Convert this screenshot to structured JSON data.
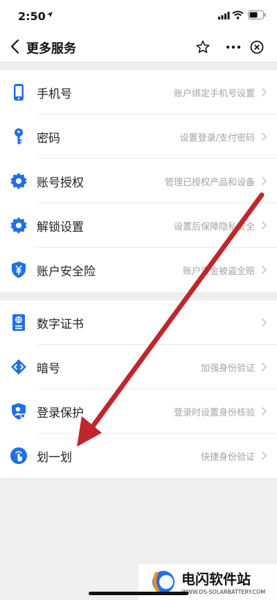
{
  "status_bar": {
    "time": "2:50",
    "icons": [
      "location-arrow-icon",
      "signal-icon",
      "wifi-icon",
      "battery-icon"
    ]
  },
  "nav": {
    "title": "更多服务",
    "icons": [
      "back-icon",
      "star-icon",
      "more-icon",
      "close-icon"
    ]
  },
  "group1": [
    {
      "label": "手机号",
      "desc": "账户绑定手机号设置",
      "icon": "phone-icon"
    },
    {
      "label": "密码",
      "desc": "设置登录/支付密码",
      "icon": "key-icon"
    },
    {
      "label": "账号授权",
      "desc": "管理已授权产品和设备",
      "icon": "gear-icon"
    },
    {
      "label": "解锁设置",
      "desc": "设置后保障隐私安全",
      "icon": "gear-icon"
    },
    {
      "label": "账户安全险",
      "desc": "账户资金被盗全赔",
      "icon": "yuan-shield-icon"
    }
  ],
  "group2": [
    {
      "label": "数字证书",
      "desc": "",
      "icon": "passport-icon"
    },
    {
      "label": "暗号",
      "desc": "加强身份验证",
      "icon": "diamond-code-icon"
    },
    {
      "label": "登录保护",
      "desc": "登录时设置身份核验",
      "icon": "user-shield-icon"
    },
    {
      "label": "划一划",
      "desc": "快捷身份验证",
      "icon": "swipe-hand-icon"
    }
  ],
  "colors": {
    "accent": "#1f6fe8",
    "annotation_arrow": "#c0262b",
    "background": "#efefef"
  },
  "watermark": {
    "title": "电闪软件站",
    "url": "WWW.DS-SOLARBATTERY.COM"
  }
}
